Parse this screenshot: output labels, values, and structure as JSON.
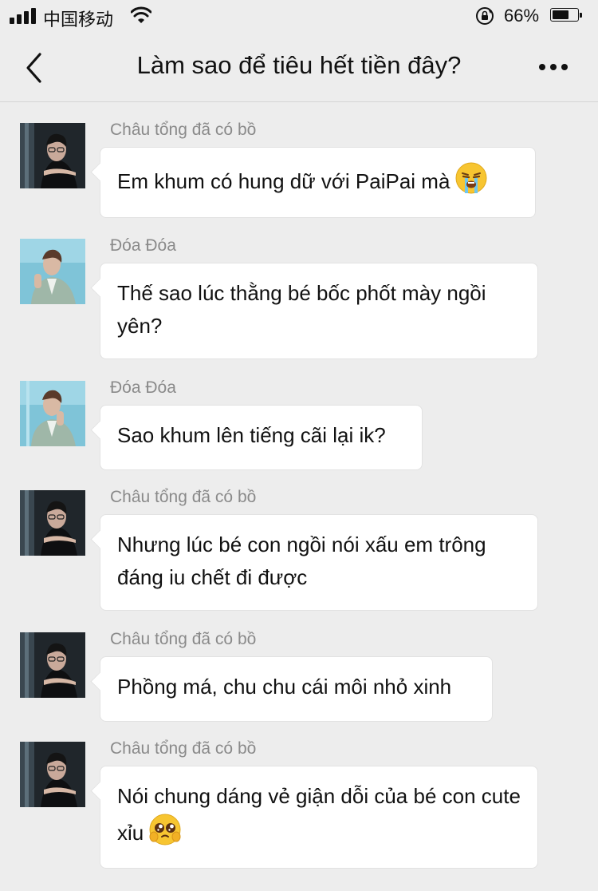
{
  "status_bar": {
    "carrier": "中国移动",
    "battery": "66%",
    "battery_level": 0.66,
    "icons": [
      "signal-icon",
      "wifi-icon",
      "rotation-lock-icon",
      "battery-icon"
    ]
  },
  "nav": {
    "back_icon": "chevron-left-icon",
    "title": "Làm sao để tiêu hết tiền đây?",
    "more_icon": "more-dots-icon"
  },
  "messages": [
    {
      "sender": "Châu tổng đã có bồ",
      "text": "Em khum có hung dữ với PaiPai mà",
      "emoji": "crying-face-emoji",
      "avatar": "avatar-chau"
    },
    {
      "sender": "Đóa Đóa",
      "text": "Thế sao lúc thằng bé bốc phốt mày ngồi yên?",
      "avatar": "avatar-doa"
    },
    {
      "sender": "Đóa Đóa",
      "text": "Sao khum lên tiếng cãi lại ik?",
      "avatar": "avatar-doa"
    },
    {
      "sender": "Châu tổng đã có bồ",
      "text": "Nhưng lúc bé con ngồi nói xấu em trông đáng iu chết đi được",
      "avatar": "avatar-chau"
    },
    {
      "sender": "Châu tổng đã có bồ",
      "text": "Phồng má, chu chu cái môi nhỏ xinh",
      "avatar": "avatar-chau"
    },
    {
      "sender": "Châu tổng đã có bồ",
      "text": "Nói chung dáng vẻ giận dỗi của bé con cute xỉu",
      "emoji": "pleading-face-emoji",
      "avatar": "avatar-chau"
    }
  ],
  "colors": {
    "background": "#ededed",
    "bubble": "#ffffff",
    "sender": "#8a8a8a",
    "text": "#111111"
  }
}
